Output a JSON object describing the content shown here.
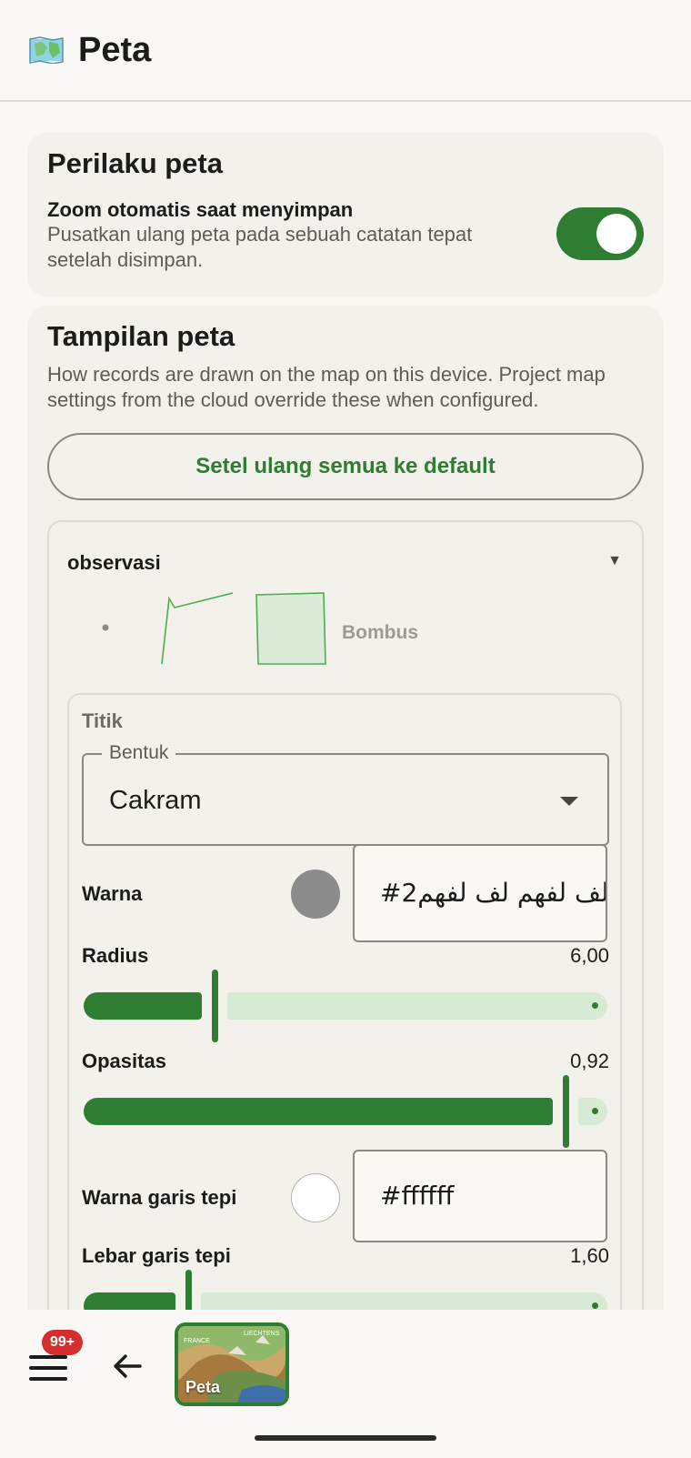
{
  "header": {
    "title": "Peta"
  },
  "map_behavior": {
    "title": "Perilaku peta",
    "auto_zoom": {
      "label": "Zoom otomatis saat menyimpan",
      "description": "Pusatkan ulang peta pada sebuah catatan tepat setelah disimpan.",
      "enabled": true
    }
  },
  "map_display": {
    "title": "Tampilan peta",
    "description": "How records are drawn on the map on this device. Project map settings from the cloud override these when configured.",
    "reset_label": "Setel ulang semua ke default",
    "layer": {
      "name": "observasi",
      "preview_label": "Bombus",
      "points": {
        "section_title": "Titik",
        "shape_legend": "Bentuk",
        "shape_value": "Cakram",
        "color_label": "Warna",
        "color_value": "#2لف لفهم لف لفهم",
        "color_swatch": "#8c8c8c",
        "radius_label": "Radius",
        "radius_value": "6,00",
        "radius_fraction": 0.25,
        "opacity_label": "Opasitas",
        "opacity_value": "0,92",
        "opacity_fraction": 0.92,
        "stroke_color_label": "Warna garis tepi",
        "stroke_color_value": "#ffffff",
        "stroke_color_swatch": "#ffffff",
        "stroke_width_label": "Lebar garis tepi",
        "stroke_width_value": "1,60",
        "stroke_width_fraction": 0.2
      }
    }
  },
  "bottom_bar": {
    "badge": "99+",
    "map_tab_label": "Peta",
    "map_thumb_labels": [
      "FRANCE",
      "LIECHTENS"
    ]
  },
  "colors": {
    "accent": "#2e7d32",
    "accent_light": "#d6ead4",
    "badge": "#d32f2f"
  }
}
